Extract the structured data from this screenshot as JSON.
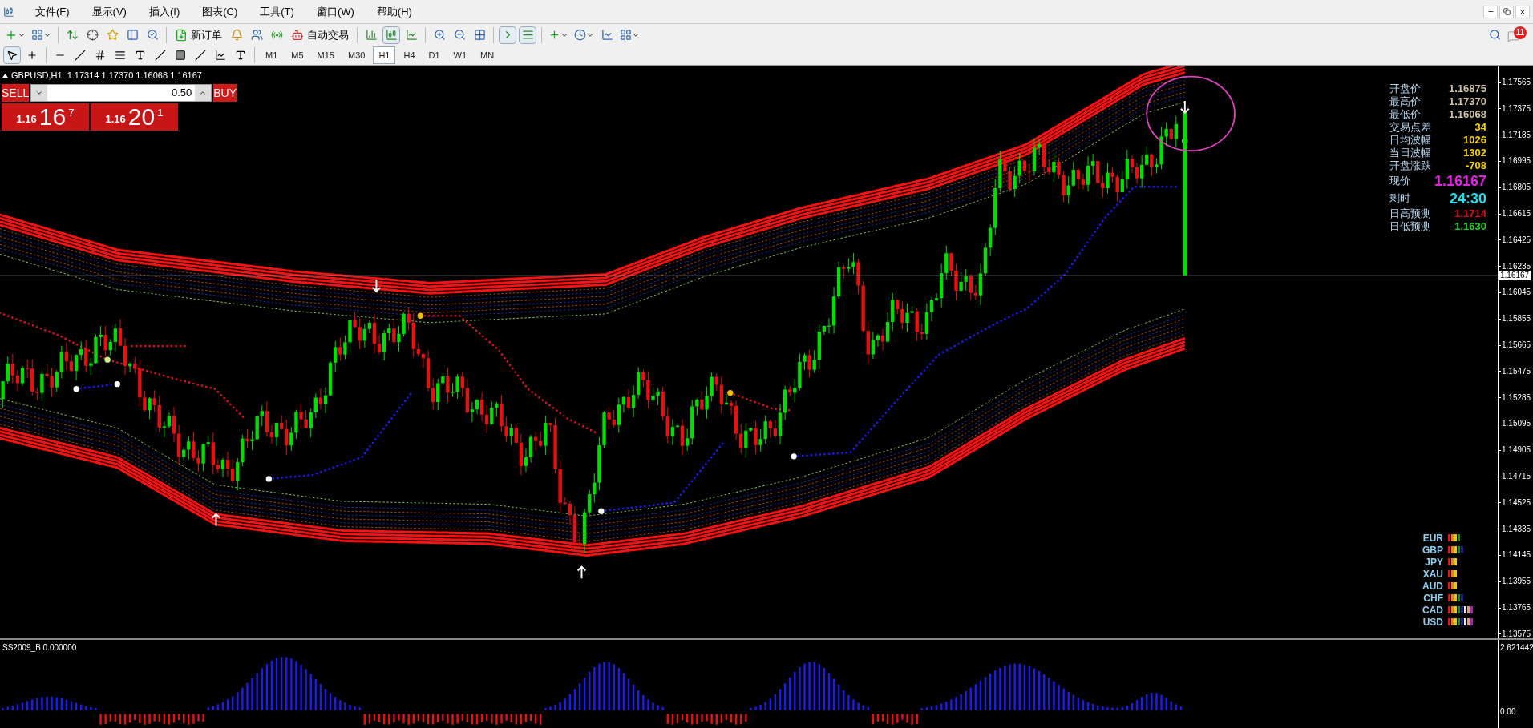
{
  "menu": [
    "文件(F)",
    "显示(V)",
    "插入(I)",
    "图表(C)",
    "工具(T)",
    "窗口(W)",
    "帮助(H)"
  ],
  "toolbar": {
    "new_order": "新订单",
    "auto_trading": "自动交易"
  },
  "timeframes": [
    {
      "label": "M1",
      "selected": false
    },
    {
      "label": "M5",
      "selected": false
    },
    {
      "label": "M15",
      "selected": false
    },
    {
      "label": "M30",
      "selected": false
    },
    {
      "label": "H1",
      "selected": true
    },
    {
      "label": "H4",
      "selected": false
    },
    {
      "label": "D1",
      "selected": false
    },
    {
      "label": "W1",
      "selected": false
    },
    {
      "label": "MN",
      "selected": false
    }
  ],
  "notifications": {
    "count": "11"
  },
  "symbol_bar": "GBPUSD,H1  1.17314 1.17370 1.16068 1.16167",
  "trade_panel": {
    "sell": "SELL",
    "buy": "BUY",
    "lot": "0.50",
    "sell_price": {
      "prefix": "1.16",
      "big": "16",
      "small": "7"
    },
    "buy_price": {
      "prefix": "1.16",
      "big": "20",
      "small": "1"
    }
  },
  "info_panel": [
    {
      "label": "开盘价",
      "value": "1.16875",
      "color": "#d2c3a5",
      "kind": "normal"
    },
    {
      "label": "最高价",
      "value": "1.17370",
      "color": "#d2c3a5",
      "kind": "normal"
    },
    {
      "label": "最低价",
      "value": "1.16068",
      "color": "#d2c3a5",
      "kind": "normal"
    },
    {
      "label": "交易点差",
      "value": "34",
      "color": "#f5d10a",
      "kind": "normal"
    },
    {
      "label": "日均波幅",
      "value": "1026",
      "color": "#f5d10a",
      "kind": "normal"
    },
    {
      "label": "当日波幅",
      "value": "1302",
      "color": "#f5d10a",
      "kind": "normal"
    },
    {
      "label": "开盘涨跌",
      "value": "-708",
      "color": "#f5d10a",
      "kind": "normal"
    },
    {
      "label": "现价",
      "value": "1.16167",
      "color": "#e81ee8",
      "kind": "large"
    },
    {
      "label": "剩时",
      "value": "24:30",
      "color": "#22e0f0",
      "kind": "large"
    },
    {
      "label": "日高预测",
      "value": "1.1714",
      "color": "#e0101a",
      "kind": "normal"
    },
    {
      "label": "日低预测",
      "value": "1.1630",
      "color": "#22d022",
      "kind": "normal"
    }
  ],
  "currencies": [
    {
      "name": "EUR",
      "bars": [
        {
          "color": "#e01818"
        },
        {
          "color": "#f08000"
        },
        {
          "color": "#e8c800"
        },
        {
          "color": "#208a20"
        }
      ]
    },
    {
      "name": "GBP",
      "bars": [
        {
          "color": "#e01818"
        },
        {
          "color": "#f08000"
        },
        {
          "color": "#e8c800"
        },
        {
          "color": "#208a20"
        },
        {
          "color": "#1a1ab0"
        }
      ]
    },
    {
      "name": "JPY",
      "bars": [
        {
          "color": "#e01818"
        },
        {
          "color": "#f08000"
        },
        {
          "color": "#e8c800"
        }
      ]
    },
    {
      "name": "XAU",
      "bars": [
        {
          "color": "#e01818"
        },
        {
          "color": "#f08000"
        },
        {
          "color": "#e8c800"
        }
      ]
    },
    {
      "name": "AUD",
      "bars": [
        {
          "color": "#e01818"
        },
        {
          "color": "#f08000"
        },
        {
          "color": "#e8c800"
        }
      ]
    },
    {
      "name": "CHF",
      "bars": [
        {
          "color": "#e01818"
        },
        {
          "color": "#f08000"
        },
        {
          "color": "#e8c800"
        },
        {
          "color": "#208a20"
        },
        {
          "color": "#1a1ab0"
        }
      ]
    },
    {
      "name": "CAD",
      "bars": [
        {
          "color": "#e01818"
        },
        {
          "color": "#f08000"
        },
        {
          "color": "#e8c800"
        },
        {
          "color": "#208a20"
        },
        {
          "color": "#1a1ab0"
        },
        {
          "color": "#f0e8e0"
        },
        {
          "color": "#d8a080"
        },
        {
          "color": "#b020b0"
        }
      ]
    },
    {
      "name": "USD",
      "bars": [
        {
          "color": "#e01818"
        },
        {
          "color": "#f08000"
        },
        {
          "color": "#e8c800"
        },
        {
          "color": "#208a20"
        },
        {
          "color": "#1a1ab0"
        },
        {
          "color": "#f0e8e0"
        },
        {
          "color": "#d8a080"
        },
        {
          "color": "#b020b0"
        }
      ]
    }
  ],
  "price_axis": {
    "ticks": [
      "1.17565",
      "1.17375",
      "1.17185",
      "1.16995",
      "1.16805",
      "1.16615",
      "1.16425",
      "1.16235",
      "1.16045",
      "1.15855",
      "1.15665",
      "1.15475",
      "1.15285",
      "1.15095",
      "1.14905",
      "1.14715",
      "1.14525",
      "1.14335",
      "1.14145",
      "1.13955",
      "1.13765",
      "1.13575"
    ],
    "current": "1.16167"
  },
  "indicator": {
    "label": "SS2009_B 0.000000",
    "max": "2.621442",
    "zero": "0.00"
  }
}
